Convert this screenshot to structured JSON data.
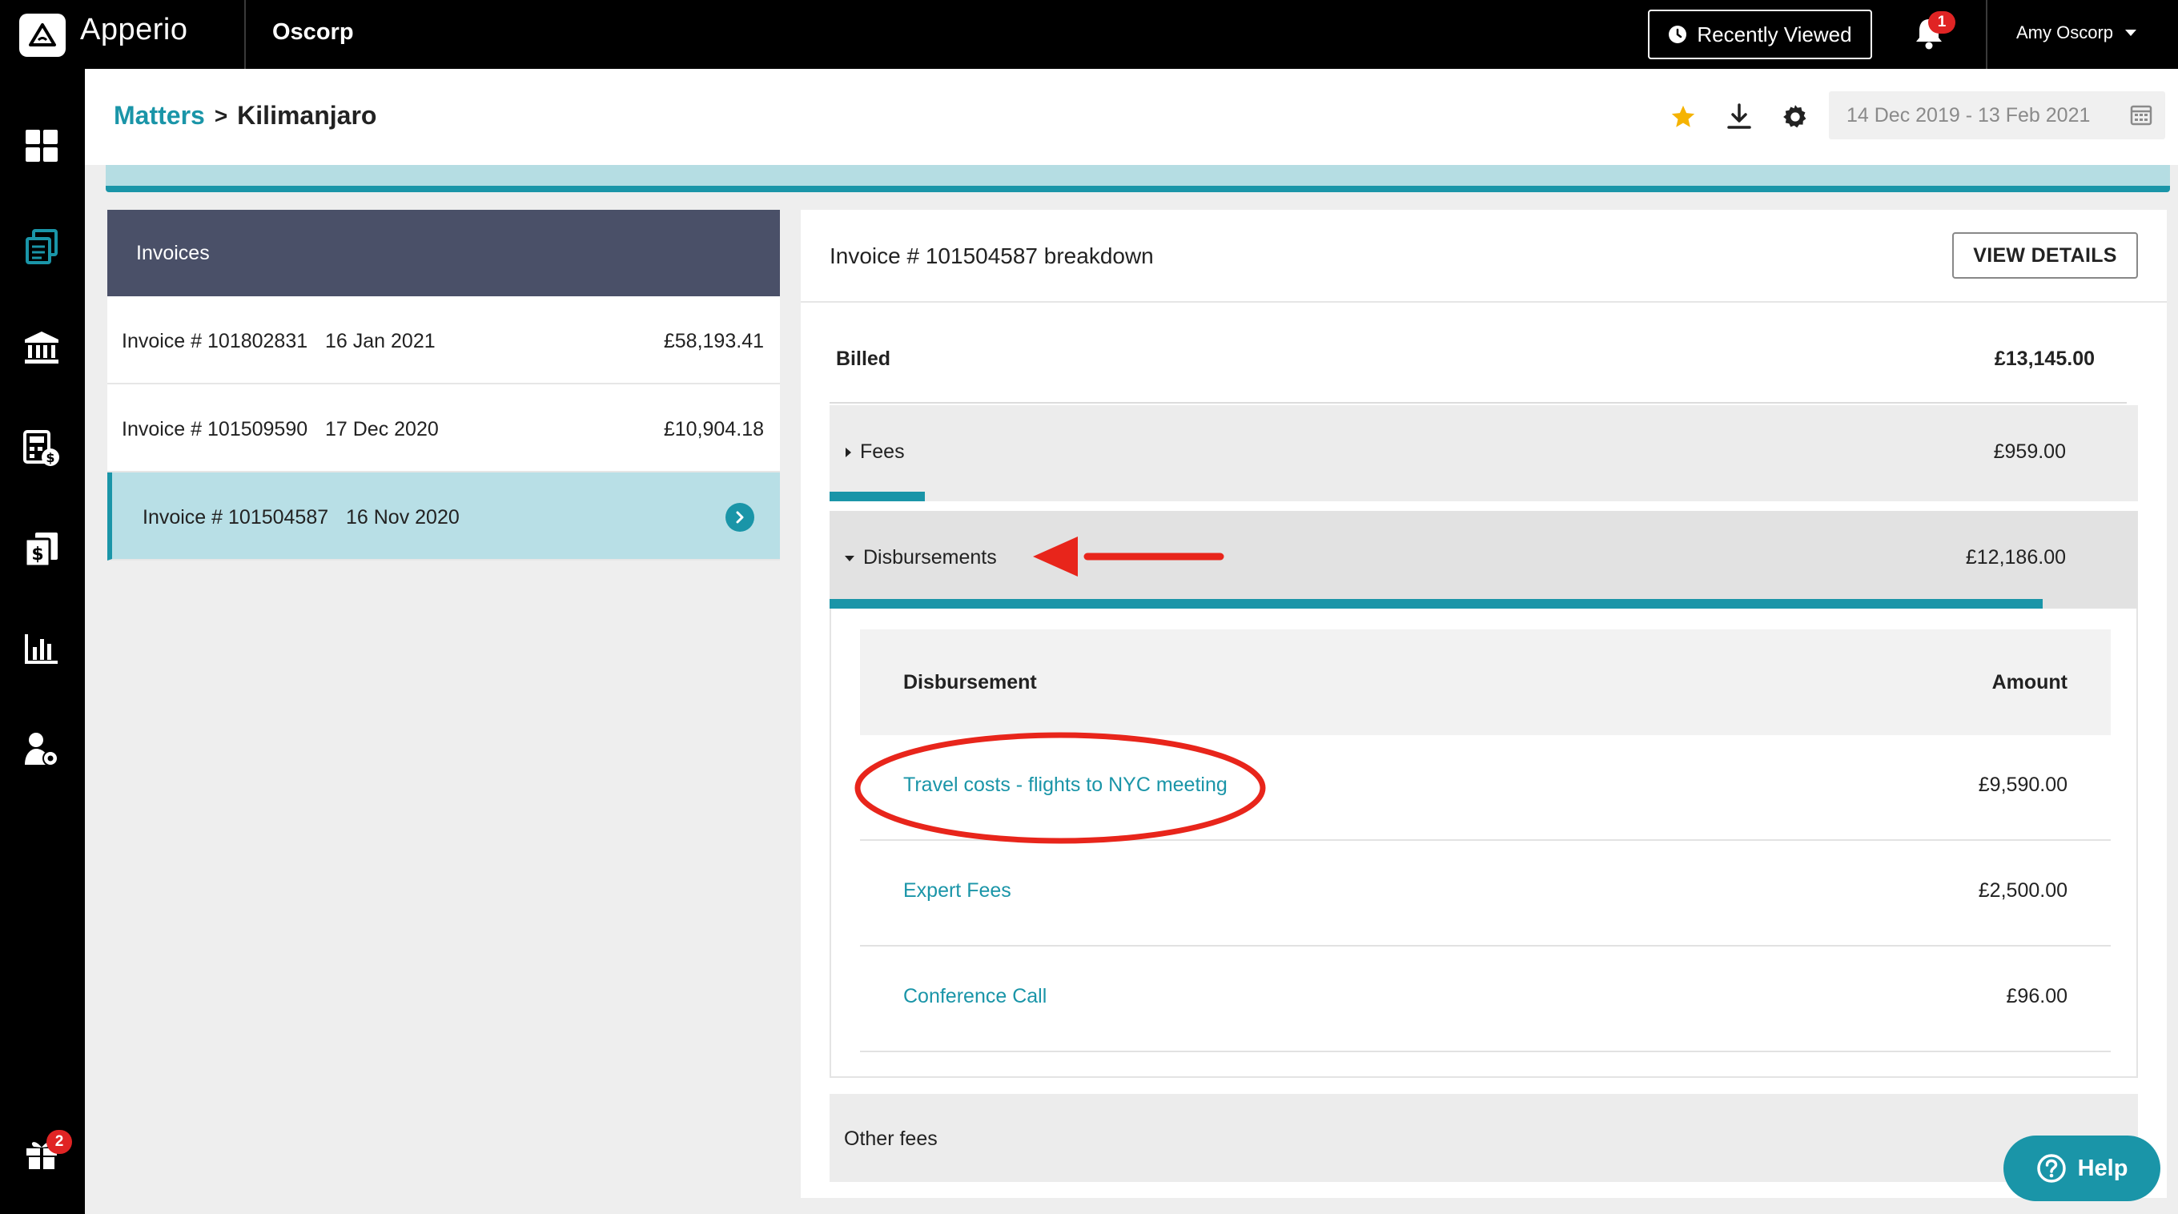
{
  "app": {
    "brand": "Apperio",
    "org": "Oscorp",
    "recently_viewed": "Recently Viewed",
    "notifications_count": "1",
    "user_name": "Amy Oscorp",
    "gift_count": "2",
    "help_label": "Help"
  },
  "breadcrumb": {
    "parent": "Matters",
    "separator": ">",
    "current": "Kilimanjaro"
  },
  "date_range": "14 Dec 2019 - 13 Feb 2021",
  "colors": {
    "accent": "#1a95a8",
    "nav": "#000000",
    "panel_header": "#4a5068",
    "annotation": "#e8251b"
  },
  "invoices": {
    "title": "Invoices",
    "items": [
      {
        "label": "Invoice # 101802831",
        "date": "16 Jan 2021",
        "amount": "£58,193.41"
      },
      {
        "label": "Invoice # 101509590",
        "date": "17 Dec 2020",
        "amount": "£10,904.18"
      },
      {
        "label": "Invoice # 101504587",
        "date": "16 Nov 2020",
        "amount": ""
      }
    ]
  },
  "breakdown": {
    "title": "Invoice # 101504587 breakdown",
    "view_details": "VIEW DETAILS",
    "billed_label": "Billed",
    "billed_amount": "£13,145.00",
    "fees": {
      "label": "Fees",
      "amount": "£959.00",
      "share": 0.073
    },
    "disbursements": {
      "label": "Disbursements",
      "amount": "£12,186.00",
      "share": 0.927
    },
    "table": {
      "col_name": "Disbursement",
      "col_amount": "Amount",
      "rows": [
        {
          "name": "Travel costs - flights to NYC meeting",
          "amount": "£9,590.00"
        },
        {
          "name": "Expert Fees",
          "amount": "£2,500.00"
        },
        {
          "name": "Conference Call",
          "amount": "£96.00"
        }
      ]
    },
    "other_fees": {
      "label": "Other fees",
      "amount": "£0"
    }
  }
}
